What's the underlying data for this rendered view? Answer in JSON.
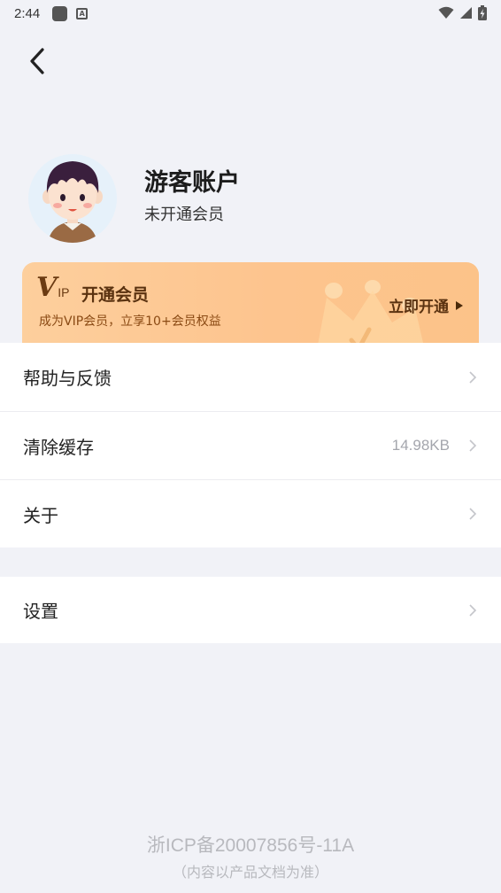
{
  "status_bar": {
    "time": "2:44",
    "icons": [
      "app-square-icon",
      "a-box-icon",
      "wifi-icon",
      "signal-icon",
      "battery-charging-icon"
    ]
  },
  "nav": {
    "back_icon": "chevron-left-icon"
  },
  "profile": {
    "name": "游客账户",
    "membership_status": "未开通会员"
  },
  "vip_banner": {
    "logo_v": "V",
    "logo_ip": "IP",
    "title": "开通会员",
    "subtitle": "成为VIP会员，立享10+会员权益",
    "cta": "立即开通"
  },
  "menu": {
    "group1": [
      {
        "label": "帮助与反馈",
        "value": ""
      },
      {
        "label": "清除缓存",
        "value": "14.98KB"
      },
      {
        "label": "关于",
        "value": ""
      }
    ],
    "group2": [
      {
        "label": "设置",
        "value": ""
      }
    ]
  },
  "footer": {
    "icp": "浙ICP备20007856号-11A",
    "note": "（内容以产品文档为准）"
  },
  "colors": {
    "background": "#f1f2f7",
    "vip_gradient_start": "#fdcf9d",
    "vip_text": "#5a3210"
  }
}
